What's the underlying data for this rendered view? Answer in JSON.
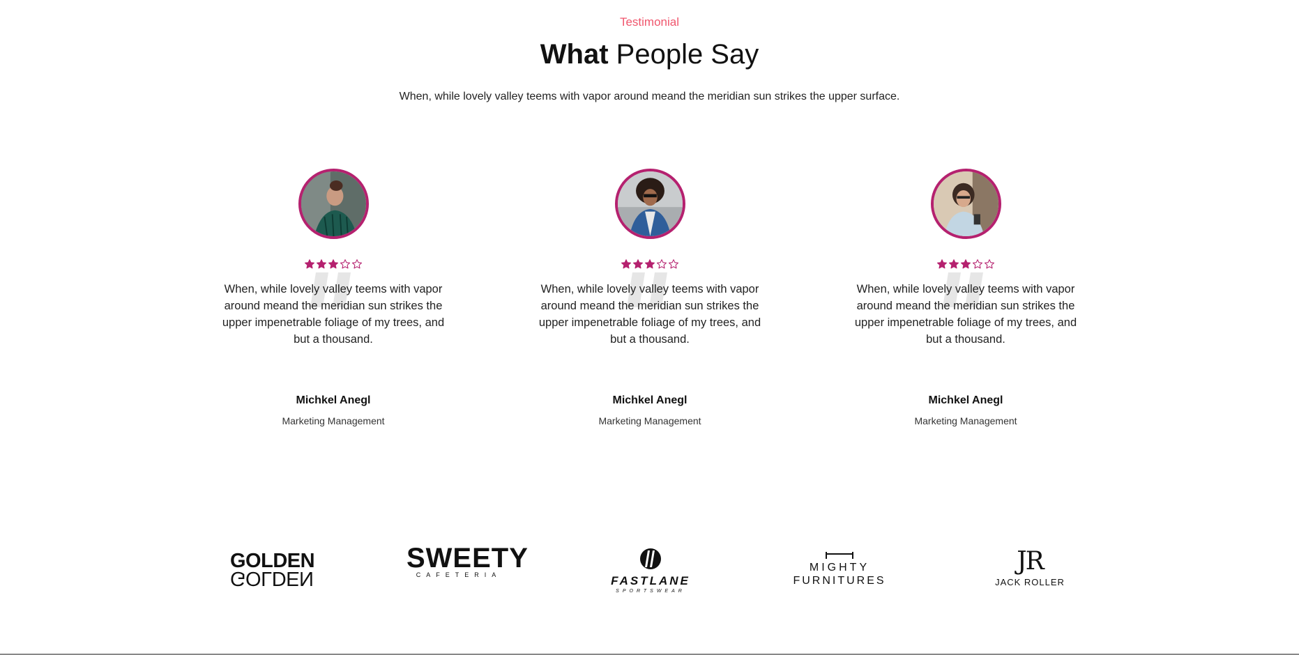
{
  "header": {
    "eyebrow": "Testimonial",
    "title_bold": "What",
    "title_rest": " People Say",
    "subtitle": "When, while lovely valley teems with vapor around meand the meridian sun strikes the upper surface."
  },
  "testimonials": [
    {
      "rating": 3,
      "max_rating": 5,
      "text": "When, while lovely valley teems with vapor around meand the meridian sun strikes the upper impenetrable foliage of my trees, and but a thousand.",
      "name": "Michkel Anegl",
      "role": "Marketing Management"
    },
    {
      "rating": 3,
      "max_rating": 5,
      "text": "When, while lovely valley teems with vapor around meand the meridian sun strikes the upper impenetrable foliage of my trees, and but a thousand.",
      "name": "Michkel Anegl",
      "role": "Marketing Management"
    },
    {
      "rating": 3,
      "max_rating": 5,
      "text": "When, while lovely valley teems with vapor around meand the meridian sun strikes the upper impenetrable foliage of my trees, and but a thousand.",
      "name": "Michkel Anegl",
      "role": "Marketing Management"
    }
  ],
  "logos": {
    "golden": "GOLDEN",
    "sweety": "SWEETY",
    "sweety_sub": "CAFETERIA",
    "fastlane": "FASTLANE",
    "fastlane_sub": "SPORTSWEAR",
    "mighty_1": "MIGHTY",
    "mighty_2": "FURNITURES",
    "jack_mark": "JR",
    "jack_name": "JACK ROLLER"
  },
  "colors": {
    "accent": "#b5216f",
    "eyebrow": "#f0566d",
    "quote_mark": "#e6e6e6"
  }
}
